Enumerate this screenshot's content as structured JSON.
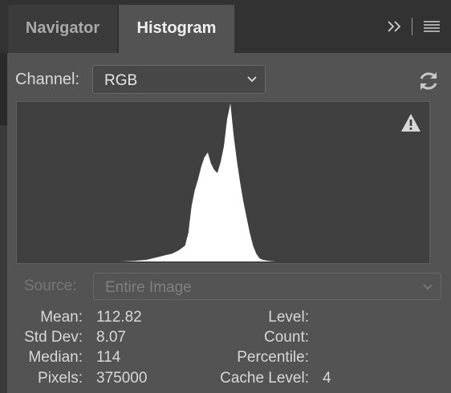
{
  "tabs": [
    {
      "label": "Navigator",
      "active": false
    },
    {
      "label": "Histogram",
      "active": true
    }
  ],
  "icons": {
    "expand": "double-chevron-right-icon",
    "menu": "hamburger-menu-icon",
    "refresh": "refresh-icon",
    "warning": "warning-icon",
    "dropdown": "chevron-down-icon"
  },
  "channel": {
    "label": "Channel:",
    "value": "RGB"
  },
  "source": {
    "label": "Source:",
    "value": "Entire Image",
    "disabled": true
  },
  "stats": {
    "left": [
      {
        "label": "Mean:",
        "value": "112.82"
      },
      {
        "label": "Std Dev:",
        "value": "8.07"
      },
      {
        "label": "Median:",
        "value": "114"
      },
      {
        "label": "Pixels:",
        "value": "375000"
      }
    ],
    "right": [
      {
        "label": "Level:",
        "value": ""
      },
      {
        "label": "Count:",
        "value": ""
      },
      {
        "label": "Percentile:",
        "value": ""
      },
      {
        "label": "Cache Level:",
        "value": "4"
      }
    ]
  },
  "colors": {
    "panel": "#535353",
    "tabbar": "#323232",
    "histogram_bg": "#404040",
    "histogram_fill": "#ffffff",
    "text": "#d8d8d8",
    "disabled_text": "#777777"
  },
  "chart_data": {
    "type": "area",
    "x": [
      0,
      8,
      16,
      24,
      32,
      40,
      48,
      56,
      64,
      72,
      80,
      84,
      88,
      92,
      96,
      100,
      104,
      106,
      108,
      110,
      112,
      114,
      116,
      118,
      120,
      122,
      124,
      126,
      128,
      130,
      132,
      134,
      136,
      138,
      140,
      142,
      144,
      146,
      148,
      150,
      152,
      156,
      160,
      168,
      176,
      184,
      192,
      200,
      208,
      216,
      224,
      232,
      240,
      248,
      255
    ],
    "values": [
      0,
      0,
      0,
      0,
      0,
      0,
      0,
      0,
      0,
      0.3,
      1,
      2,
      3,
      4,
      5,
      7,
      10,
      18,
      35,
      45,
      52,
      60,
      66,
      69,
      62,
      58,
      56,
      63,
      73,
      90,
      100,
      80,
      64,
      50,
      38,
      28,
      18,
      10,
      5,
      2,
      1,
      0.3,
      0,
      0,
      0,
      0,
      0,
      0,
      0,
      0,
      0,
      0,
      0,
      0,
      0
    ],
    "xlim": [
      0,
      255
    ],
    "ylim": [
      0,
      100
    ]
  }
}
